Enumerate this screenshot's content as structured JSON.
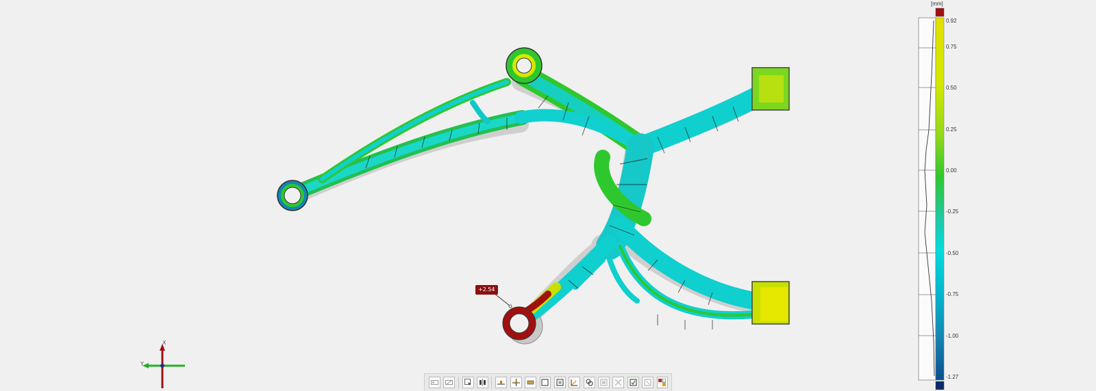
{
  "viewport": {
    "deviation_callout": "+2.54"
  },
  "axis_triad": {
    "x_label": "X",
    "y_label": "Y"
  },
  "color_legend": {
    "unit": "[mm]",
    "ticks": [
      "0.92",
      "0.75",
      "0.50",
      "0.25",
      "0.00",
      "-0.25",
      "-0.50",
      "-0.75",
      "-1.00",
      "-1.27"
    ],
    "colors": {
      "over_range": "#a01010",
      "max": "#e8e800",
      "mid": "#2ec82e",
      "low": "#00d7d7",
      "min": "#0a5c9c",
      "under_range": "#0a2a6a"
    }
  },
  "toolbar": {
    "buttons": [
      "view-icon",
      "section-view-icon",
      "select-icon",
      "compare-icon",
      "align-icon",
      "snap-icon",
      "deviation-label-icon",
      "frame-icon",
      "fit-view-icon",
      "measure-icon",
      "link-icon",
      "group-icon",
      "expand-icon",
      "report-icon",
      "disabled-report-icon",
      "settings-icon"
    ]
  }
}
